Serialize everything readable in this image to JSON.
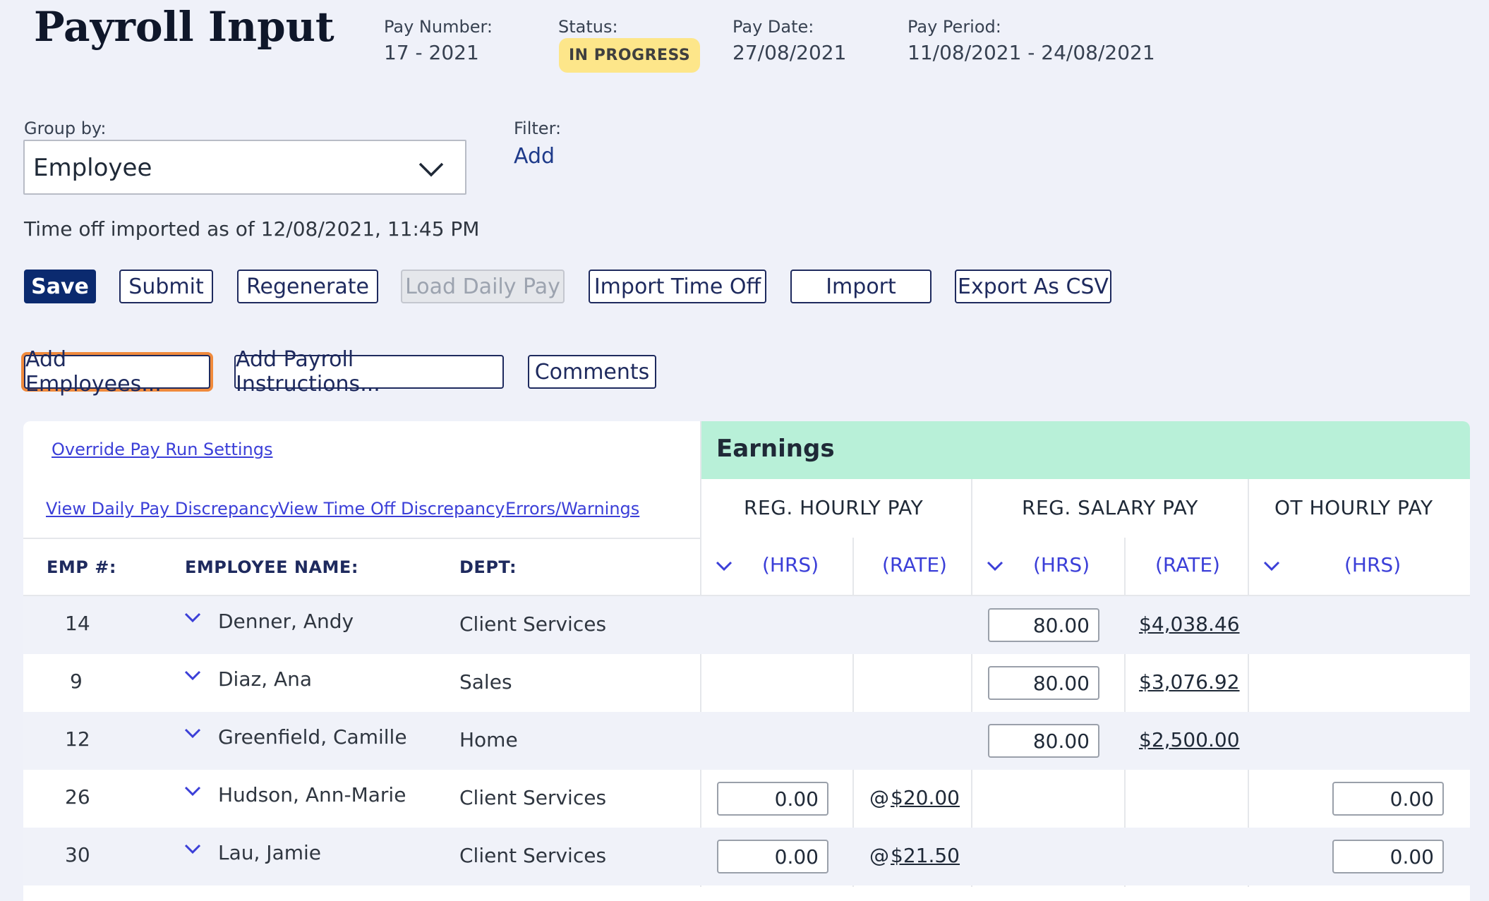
{
  "header": {
    "title": "Payroll Input",
    "pay_number_label": "Pay Number:",
    "pay_number": "17 - 2021",
    "status_label": "Status:",
    "status": "IN PROGRESS",
    "pay_date_label": "Pay Date:",
    "pay_date": "27/08/2021",
    "pay_period_label": "Pay Period:",
    "pay_period": "11/08/2021 - 24/08/2021"
  },
  "group_by": {
    "label": "Group by:",
    "value": "Employee"
  },
  "filter": {
    "label": "Filter:",
    "add": "Add"
  },
  "time_off_note": "Time off imported as of 12/08/2021, 11:45 PM",
  "toolbar": {
    "save": "Save",
    "submit": "Submit",
    "regenerate": "Regenerate",
    "load_daily_pay": "Load Daily Pay",
    "import_time_off": "Import Time Off",
    "import": "Import",
    "export_csv": "Export As CSV"
  },
  "actions": {
    "add_employees": "Add Employees...",
    "add_payroll_instructions": "Add Payroll Instructions...",
    "comments": "Comments"
  },
  "links": {
    "override": "Override Pay Run Settings",
    "daily_pay_discrepancy": "View Daily Pay Discrepancy",
    "time_off_discrepancy": "View Time Off Discrepancy",
    "errors_warnings": "Errors/Warnings"
  },
  "table": {
    "earnings_title": "Earnings",
    "groups": [
      "REG. HOURLY PAY",
      "REG. SALARY PAY",
      "OT HOURLY PAY"
    ],
    "columns": {
      "emp": "EMP #:",
      "name": "EMPLOYEE NAME:",
      "dept": "DEPT:"
    },
    "sub": {
      "hrs": "(HRS)",
      "rate": "(RATE)"
    },
    "rows": [
      {
        "emp": "14",
        "name": "Denner, Andy",
        "dept": "Client Services",
        "sal_hrs": "80.00",
        "sal_rate": "$4,038.46"
      },
      {
        "emp": "9",
        "name": "Diaz, Ana",
        "dept": "Sales",
        "sal_hrs": "80.00",
        "sal_rate": "$3,076.92"
      },
      {
        "emp": "12",
        "name": "Greenfield, Camille",
        "dept": "Home",
        "sal_hrs": "80.00",
        "sal_rate": "$2,500.00"
      },
      {
        "emp": "26",
        "name": "Hudson, Ann-Marie",
        "dept": "Client Services",
        "hr_hrs": "0.00",
        "at": "@",
        "hr_rate": "$20.00",
        "ot_hrs": "0.00"
      },
      {
        "emp": "30",
        "name": "Lau, Jamie",
        "dept": "Client Services",
        "hr_hrs": "0.00",
        "at": "@",
        "hr_rate": "$21.50",
        "ot_hrs": "0.00"
      }
    ]
  }
}
